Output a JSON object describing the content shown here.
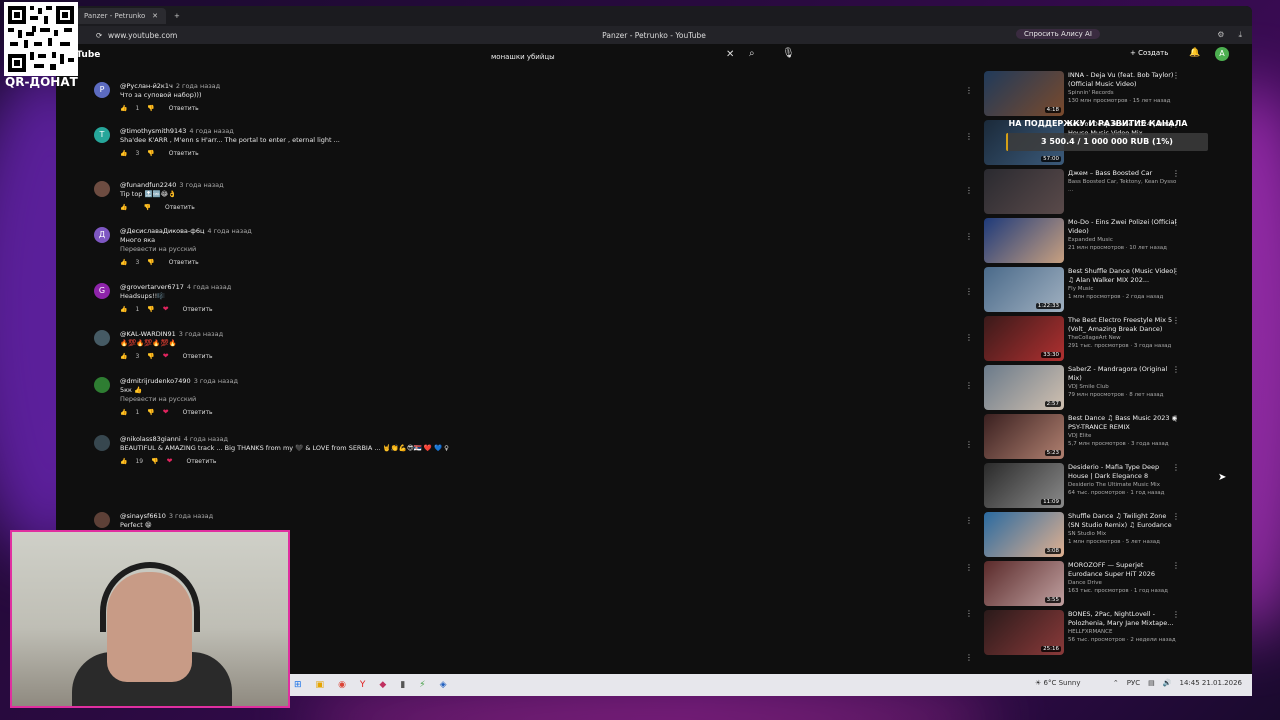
{
  "browser": {
    "tab_title": "Panzer - Petrunko - YouTube",
    "url": "www.youtube.com",
    "page_title": "Panzer - Petrunko - YouTube",
    "alisa_button": "Спросить Алису AI"
  },
  "youtube": {
    "logo": "YouTube",
    "search_value": "монашки убийцы",
    "create_label": "Создать",
    "account_initial": "A"
  },
  "comments": [
    {
      "avatar": "P",
      "avatar_color": "#5c6bc0",
      "author": "@Руслан-й2к1ч",
      "time": "2 года назад",
      "text": "Что за суповой набор)))",
      "translate": "",
      "likes": "1",
      "reply": "Ответить",
      "hearted": false
    },
    {
      "avatar": "T",
      "avatar_color": "#26a69a",
      "author": "@timothysmith9143",
      "time": "4 года назад",
      "text": "Sha'dee K'ARR , M'enn s H'arr... The portal to enter , eternal light ...",
      "translate": "",
      "likes": "3",
      "reply": "Ответить",
      "hearted": false
    },
    {
      "avatar": "",
      "avatar_color": "#6d4c41",
      "author": "@funandfun2240",
      "time": "3 года назад",
      "text": "Tip top 🔝🆒😂👌",
      "translate": "",
      "likes": "",
      "reply": "Ответить",
      "hearted": false
    },
    {
      "avatar": "Д",
      "avatar_color": "#7e57c2",
      "author": "@ДесиславаДикова-ф6ц",
      "time": "4 года назад",
      "text": "Много яка",
      "translate": "Перевести на русский",
      "likes": "3",
      "reply": "Ответить",
      "hearted": false
    },
    {
      "avatar": "G",
      "avatar_color": "#8e24aa",
      "author": "@grovertarver6717",
      "time": "4 года назад",
      "text": "Headsups!!🎼",
      "translate": "",
      "likes": "1",
      "reply": "Ответить",
      "hearted": true
    },
    {
      "avatar": "",
      "avatar_color": "#455a64",
      "author": "@KAL-WARDIN91",
      "time": "3 года назад",
      "text": "🔥💯🔥💯🔥💯🔥",
      "translate": "",
      "likes": "3",
      "reply": "Ответить",
      "hearted": true
    },
    {
      "avatar": "",
      "avatar_color": "#2e7d32",
      "author": "@dmitrijrudenko7490",
      "time": "3 года назад",
      "text": "5кк 👍",
      "translate": "Перевести на русский",
      "likes": "1",
      "reply": "Ответить",
      "hearted": true
    },
    {
      "avatar": "",
      "avatar_color": "#37474f",
      "author": "@nikolass83gianni",
      "time": "4 года назад",
      "text": "BEAUTIFUL & AMAZING track ... Big THANKS from my 🖤 & LOVE from SERBIA ... 🤘👏💪😎🇷🇸 ❤️ 💙 ♀",
      "translate": "",
      "likes": "19",
      "reply": "Ответить",
      "hearted": true
    },
    {
      "avatar": "",
      "avatar_color": "#5d4037",
      "author": "@sinaysf6610",
      "time": "3 года назад",
      "text": "Perfect 😁",
      "translate": "",
      "likes": "",
      "reply": "",
      "hearted": false
    }
  ],
  "recommendations": [
    {
      "title": "INNA - Deja Vu (feat. Bob Taylor) (Official Music Video)",
      "channel": "Spinnin' Records",
      "meta": "130 млн просмотров · 15 лет назад",
      "duration": "4:18",
      "color1": "#203a5a",
      "color2": "#7a4a2c"
    },
    {
      "title": "Best of Deep House 2024 | Deep House Music Video Mix",
      "channel": "",
      "meta": "",
      "duration": "57:00",
      "color1": "#1b2a3a",
      "color2": "#3b5a7a"
    },
    {
      "title": "Джем – Bass Boosted Car",
      "channel": "Bass Boosted Car, Tektony, Kean Dysso ...",
      "meta": "",
      "duration": "",
      "color1": "#2a2a30",
      "color2": "#5a4a4a"
    },
    {
      "title": "Mo-Do - Eins Zwei Polizei (Official Video)",
      "channel": "Expanded Music",
      "meta": "21 млн просмотров · 10 лет назад",
      "duration": "",
      "color1": "#1e3a7a",
      "color2": "#c8a080"
    },
    {
      "title": "Best Shuffle Dance (Music Video) ♫ Alan Walker MIX 202...",
      "channel": "Fly Music",
      "meta": "1 млн просмотров · 2 года назад",
      "duration": "1:22:33",
      "color1": "#4a6a8a",
      "color2": "#a0b0c0"
    },
    {
      "title": "The Best Electro Freestyle Mix 5 (Volt_ Amazing Break Dance)",
      "channel": "TheCollageArt New",
      "meta": "291 тыс. просмотров · 3 года назад",
      "duration": "33:30",
      "color1": "#3a1a1a",
      "color2": "#b03030"
    },
    {
      "title": "SaberZ - Mandragora (Original Mix)",
      "channel": "VDJ Smile Club",
      "meta": "79 млн просмотров · 8 лет назад",
      "duration": "2:57",
      "color1": "#6a7a8a",
      "color2": "#d0c0b0"
    },
    {
      "title": "Best Dance ♫ Bass Music 2023 ◉ PSY-TRANCE REMIX",
      "channel": "VDJ Elite",
      "meta": "5,7 млн просмотров · 3 года назад",
      "duration": "5:23",
      "color1": "#3a2020",
      "color2": "#b08070"
    },
    {
      "title": "Desiderio - Mafia Type Deep House | Dark Elegance 8",
      "channel": "Desiderio The Ultimate Music Mix",
      "meta": "64 тыс. просмотров · 1 год назад",
      "duration": "11:09",
      "color1": "#2a2a2a",
      "color2": "#8a8a8a"
    },
    {
      "title": "Shuffle Dance ♫ Twilight Zone (SN Studio Remix) ♫ Eurodance",
      "channel": "SN Studio Mix",
      "meta": "1 млн просмотров · 5 лет назад",
      "duration": "3:08",
      "color1": "#2a6aa0",
      "color2": "#e0b090"
    },
    {
      "title": "MOROZOFF — Superjet Eurodance Super HiT 2026",
      "channel": "Dance Drive",
      "meta": "163 тыс. просмотров · 1 год назад",
      "duration": "3:55",
      "color1": "#5a2a2a",
      "color2": "#c0a0a0"
    },
    {
      "title": "BONES, 2Pac, NightLovell - Polozhenia, Mary Jane Mixtape...",
      "channel": "HELLFXRMANCE",
      "meta": "56 тыс. просмотров · 2 недели назад",
      "duration": "25:16",
      "color1": "#2a1a1a",
      "color2": "#8a3a3a"
    }
  ],
  "overlay": {
    "donation_title": "НА ПОДДЕРЖКУ И РАЗВИТИЕ КАНАЛА",
    "donation_value": "3 500.4 / 1 000 000 RUB (1%)",
    "donation_progress": 0.01,
    "qr_label": "QR-ДОНАТ"
  },
  "taskbar": {
    "weather": "6°C",
    "weather_desc": "Sunny",
    "lang": "РУС",
    "time": "14:45",
    "date": "21.01.2026"
  }
}
